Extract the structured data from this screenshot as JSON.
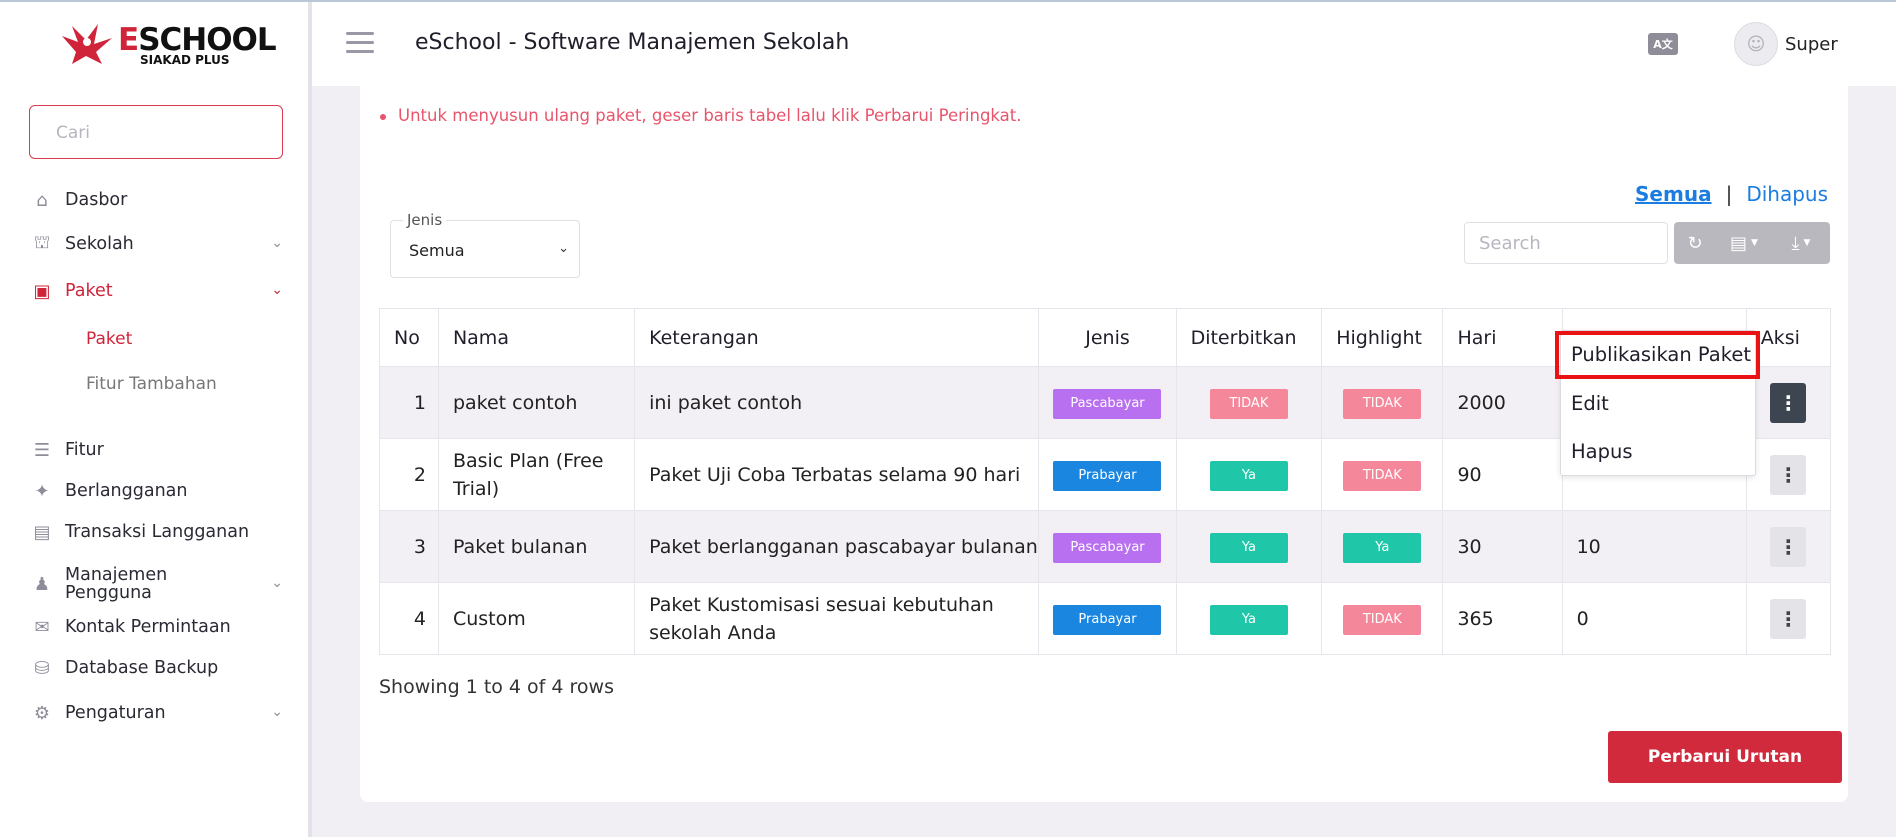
{
  "header": {
    "title": "eSchool - Software Manajemen Sekolah",
    "user_name": "Super",
    "lang_icon": "translate-icon"
  },
  "logo": {
    "brand_e": "E",
    "brand_rest": "SCHOOL",
    "sub": "SIAKAD PLUS"
  },
  "sidebar": {
    "search_placeholder": "Cari",
    "items": [
      {
        "label": "Dasbor",
        "icon": "home-icon"
      },
      {
        "label": "Sekolah",
        "icon": "bank-icon"
      },
      {
        "label": "Paket",
        "icon": "archive-icon"
      },
      {
        "label": "Fitur",
        "icon": "list-icon"
      },
      {
        "label": "Berlangganan",
        "icon": "puzzle-icon"
      },
      {
        "label": "Transaksi Langganan",
        "icon": "money-icon"
      },
      {
        "label": "Manajemen Pengguna",
        "icon": "users-icon"
      },
      {
        "label": "Kontak Permintaan",
        "icon": "envelope-icon"
      },
      {
        "label": "Database Backup",
        "icon": "database-icon"
      },
      {
        "label": "Pengaturan",
        "icon": "gear-icon"
      }
    ],
    "sub_items": [
      "Paket",
      "Fitur Tambahan"
    ]
  },
  "main": {
    "note": "Untuk menyusun ulang paket, geser baris tabel lalu klik Perbarui Peringkat.",
    "filter": {
      "all": "Semua",
      "sep": "|",
      "deleted": "Dihapus"
    },
    "jenis": {
      "label": "Jenis",
      "value": "Semua"
    },
    "search_placeholder": "Search",
    "columns": [
      "No",
      "Nama",
      "Keterangan",
      "Jenis",
      "Diterbitkan",
      "Highlight",
      "Hari",
      "",
      "Aksi"
    ],
    "rows": [
      {
        "no": "1",
        "nama": "paket contoh",
        "ket": "ini paket contoh",
        "jenis": "Pascabayar",
        "terbit": "TIDAK",
        "highlight": "TIDAK",
        "hari": "2000",
        "extra": ""
      },
      {
        "no": "2",
        "nama": "Basic Plan (Free Trial)",
        "ket": "Paket Uji Coba Terbatas selama 90 hari",
        "jenis": "Prabayar",
        "terbit": "Ya",
        "highlight": "TIDAK",
        "hari": "90",
        "extra": ""
      },
      {
        "no": "3",
        "nama": "Paket bulanan",
        "ket": "Paket berlangganan pascabayar bulanan",
        "jenis": "Pascabayar",
        "terbit": "Ya",
        "highlight": "Ya",
        "hari": "30",
        "extra": "10"
      },
      {
        "no": "4",
        "nama": "Custom",
        "ket": "Paket Kustomisasi sesuai kebutuhan sekolah Anda",
        "jenis": "Prabayar",
        "terbit": "Ya",
        "highlight": "TIDAK",
        "hari": "365",
        "extra": "0"
      }
    ],
    "showing": "Showing 1 to 4 of 4 rows",
    "update_button": "Perbarui Urutan"
  },
  "dropdown": {
    "items": [
      "Publikasikan Paket",
      "Edit",
      "Hapus"
    ]
  },
  "colors": {
    "accent": "#d0243a",
    "link": "#1c7de0",
    "postpaid": "#b86ff0",
    "prepaid": "#1a86e0",
    "no": "#f5879b",
    "yes": "#1fc7a8"
  }
}
